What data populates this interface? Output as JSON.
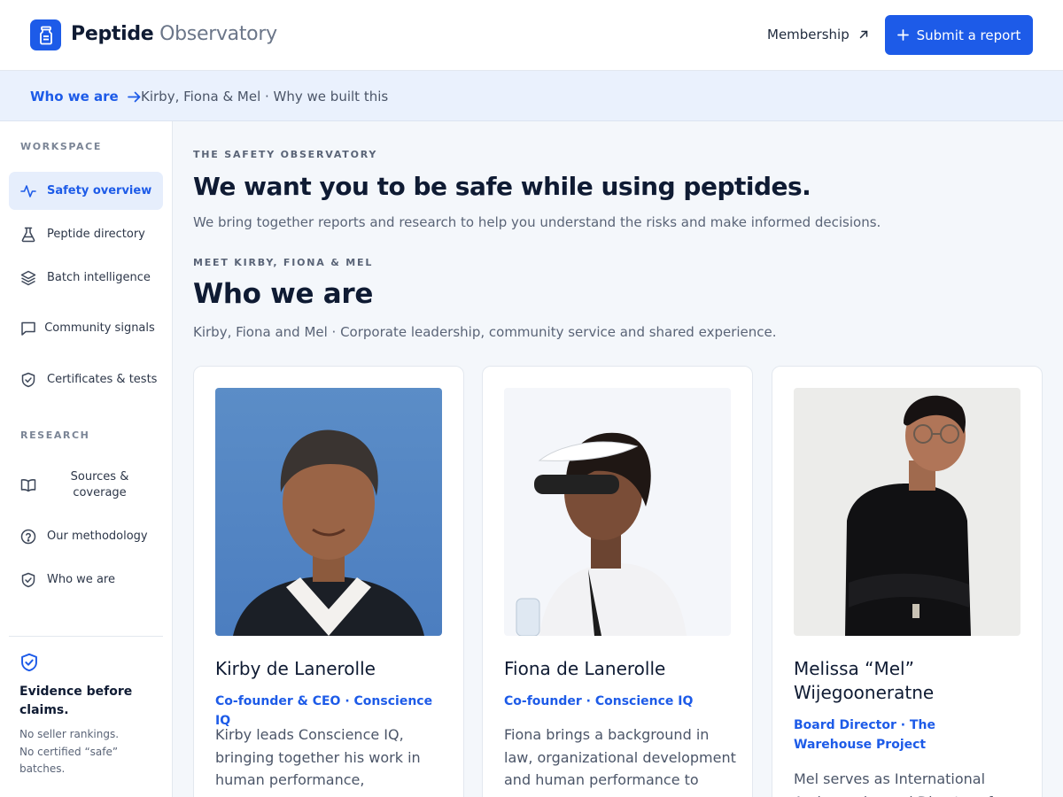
{
  "header": {
    "brand_bold": "Peptide",
    "brand_light": "Observatory",
    "membership_label": "Membership",
    "submit_label": "Submit a report"
  },
  "subbar": {
    "link_label": "Who we are",
    "text": "Kirby, Fiona & Mel · Why we built this"
  },
  "sidebar": {
    "workspace_heading": "WORKSPACE",
    "research_heading": "RESEARCH",
    "items": [
      {
        "label": "Safety overview",
        "icon": "activity-icon"
      },
      {
        "label": "Peptide directory",
        "icon": "flask-icon"
      },
      {
        "label": "Batch intelligence",
        "icon": "layers-icon"
      },
      {
        "label": "Community signals",
        "icon": "chat-icon"
      },
      {
        "label": "Certificates & tests",
        "icon": "shield-check-icon"
      },
      {
        "label": "Sources & coverage",
        "icon": "book-icon"
      },
      {
        "label": "Our methodology",
        "icon": "help-circle-icon"
      },
      {
        "label": "Who we are",
        "icon": "shield-icon"
      }
    ],
    "evidence_title": "Evidence before claims.",
    "evidence_text": "No seller rankings. No certified “safe” batches."
  },
  "main": {
    "eyebrow1": "THE SAFETY OBSERVATORY",
    "title": "We want you to be safe while using peptides.",
    "lead": "We bring together reports and research to help you understand the risks and make informed decisions.",
    "eyebrow2": "MEET KIRBY, FIONA & MEL",
    "section_title": "Who we are",
    "section_lead": "Kirby, Fiona and Mel · Corporate leadership, community service and shared experience.",
    "cards": [
      {
        "name": "Kirby de Lanerolle",
        "role": "Co-founder & CEO · Conscience IQ",
        "bio": "Kirby leads Conscience IQ, bringing together his work in human performance, psychology"
      },
      {
        "name": "Fiona de Lanerolle",
        "role": "Co-founder · Conscience IQ",
        "bio": "Fiona brings a background in law, organizational development and human performance to"
      },
      {
        "name": "Melissa “Mel” Wijegooneratne",
        "role": "Board Director · The Warehouse Project",
        "bio": "Mel serves as International Ambassador and Director of WOW"
      }
    ]
  },
  "colors": {
    "accent": "#1d5be8",
    "text": "#0f1b33",
    "muted": "#5a6477",
    "background": "#f4f7fb"
  }
}
